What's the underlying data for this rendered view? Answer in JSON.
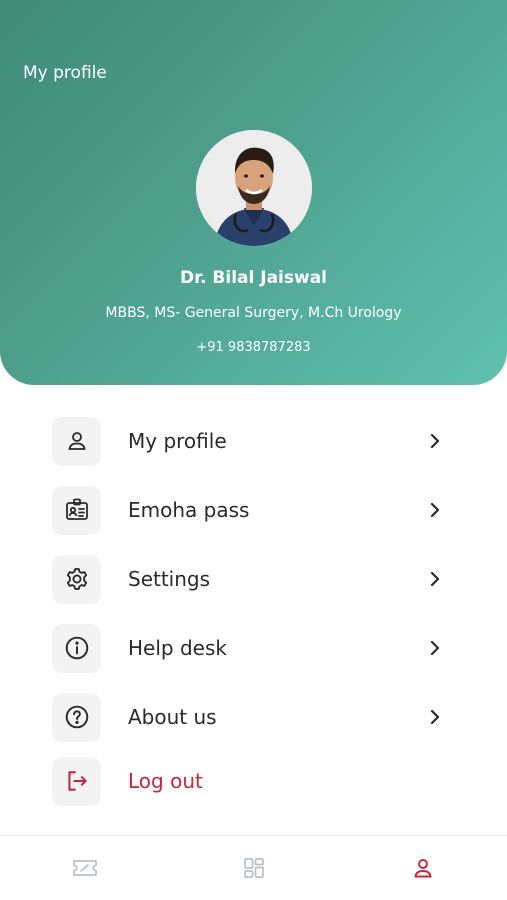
{
  "header": {
    "title": "My profile",
    "name": "Dr. Bilal Jaiswal",
    "qualification": "MBBS, MS- General Surgery, M.Ch Urology",
    "phone": "+91 9838787283"
  },
  "menu": [
    {
      "label": "My profile",
      "icon": "user-icon"
    },
    {
      "label": "Emoha pass",
      "icon": "id-card-icon"
    },
    {
      "label": "Settings",
      "icon": "gear-icon"
    },
    {
      "label": "Help desk",
      "icon": "info-icon"
    },
    {
      "label": "About us",
      "icon": "question-icon"
    },
    {
      "label": "Log out",
      "icon": "logout-icon"
    }
  ],
  "bottom_nav": [
    {
      "icon": "ticket-icon",
      "active": false
    },
    {
      "icon": "dashboard-icon",
      "active": false
    },
    {
      "icon": "profile-icon",
      "active": true
    }
  ],
  "colors": {
    "header_start": "#3f8a77",
    "header_end": "#5fc1b1",
    "logout": "#c4273a",
    "nav_active": "#c4273a",
    "nav_inactive": "#b9bfc8"
  }
}
